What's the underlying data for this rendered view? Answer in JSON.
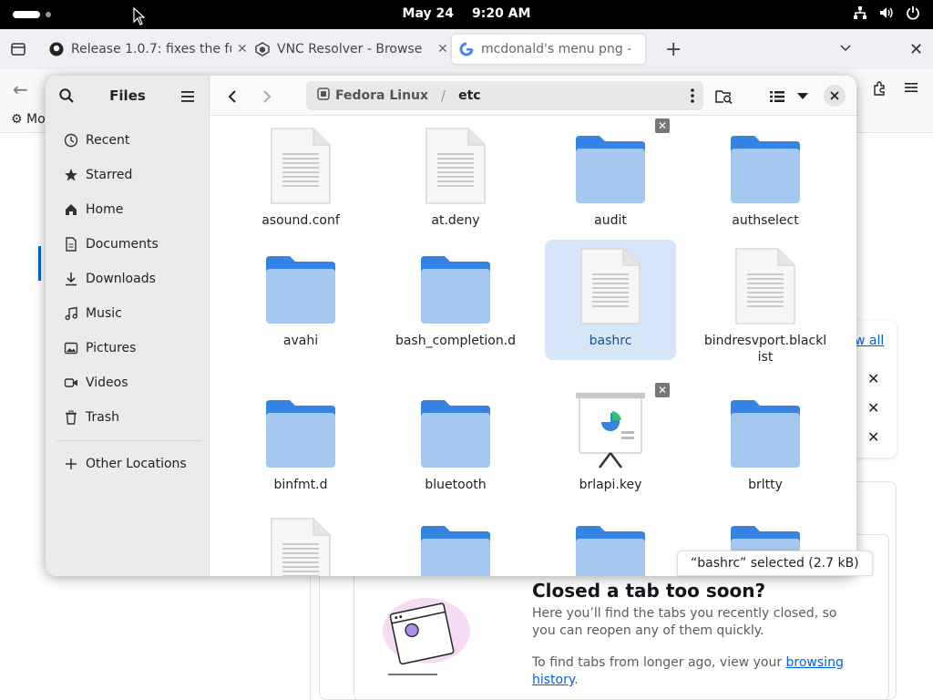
{
  "topbar": {
    "date": "May 24",
    "time": "9:20 AM"
  },
  "browser": {
    "tabs": [
      {
        "title": "Release 1.0.7: fixes the fu",
        "favicon": "github-icon"
      },
      {
        "title": "VNC Resolver - Browse",
        "favicon": "vnc-icon"
      },
      {
        "title": "mcdonald's menu png - G",
        "favicon": "google-icon"
      }
    ],
    "bookmark_partial": "Mo",
    "view_all": "w all",
    "closed_tabs": {
      "title": "Closed a tab too soon?",
      "desc": "Here you’ll find the tabs you recently closed, so you can reopen any of them quickly.",
      "desc2_prefix": "To find tabs from longer ago, view your ",
      "link": "browsing history",
      "desc2_suffix": "."
    }
  },
  "files": {
    "title": "Files",
    "places": [
      {
        "label": "Recent",
        "icon": "clock-icon"
      },
      {
        "label": "Starred",
        "icon": "star-icon"
      },
      {
        "label": "Home",
        "icon": "home-icon"
      },
      {
        "label": "Documents",
        "icon": "document-icon"
      },
      {
        "label": "Downloads",
        "icon": "download-icon"
      },
      {
        "label": "Music",
        "icon": "music-icon"
      },
      {
        "label": "Pictures",
        "icon": "picture-icon"
      },
      {
        "label": "Videos",
        "icon": "video-icon"
      },
      {
        "label": "Trash",
        "icon": "trash-icon"
      }
    ],
    "other_locations": "Other Locations",
    "path": {
      "root": "Fedora Linux",
      "current": "etc"
    },
    "items": [
      {
        "name": "asound.conf",
        "type": "text"
      },
      {
        "name": "at.deny",
        "type": "text"
      },
      {
        "name": "audit",
        "type": "folder",
        "locked": true
      },
      {
        "name": "authselect",
        "type": "folder"
      },
      {
        "name": "avahi",
        "type": "folder"
      },
      {
        "name": "bash_completion.d",
        "type": "folder"
      },
      {
        "name": "bashrc",
        "type": "text",
        "selected": true
      },
      {
        "name": "bindresvport.blacklist",
        "type": "text"
      },
      {
        "name": "binfmt.d",
        "type": "folder"
      },
      {
        "name": "bluetooth",
        "type": "folder"
      },
      {
        "name": "brlapi.key",
        "type": "presentation",
        "locked": true
      },
      {
        "name": "brltty",
        "type": "folder"
      },
      {
        "name": "",
        "type": "text"
      },
      {
        "name": "",
        "type": "folder"
      },
      {
        "name": "",
        "type": "folder"
      },
      {
        "name": "",
        "type": "folder"
      }
    ],
    "status": "“bashrc” selected  (2.7 kB)"
  }
}
